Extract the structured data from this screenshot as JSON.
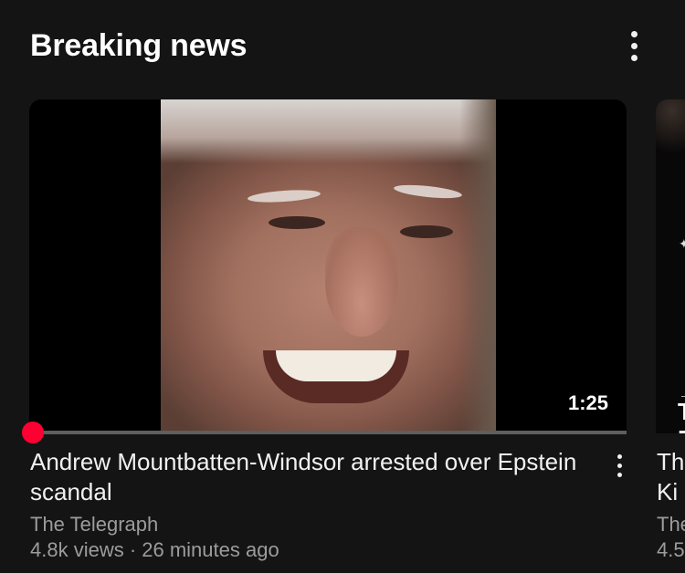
{
  "shelf": {
    "title": "Breaking news",
    "menu_icon": "more-vert-icon"
  },
  "videos": [
    {
      "title": "Andrew Mountbatten-Windsor arrested over Epstein scandal",
      "channel": "The Telegraph",
      "meta": "4.8k views · 26 minutes ago",
      "duration": "1:25",
      "progress_fraction": 0.01,
      "progress_color": "#ff0033",
      "menu_icon": "more-vert-icon"
    },
    {
      "title": "Th\nKi",
      "channel": "The",
      "meta": "4.5",
      "thumb_text": "T\nF\nT\nA"
    }
  ],
  "colors": {
    "background": "#141414",
    "text_primary": "#f1f1f1",
    "text_secondary": "#9c9c9c",
    "accent": "#ff0033"
  }
}
